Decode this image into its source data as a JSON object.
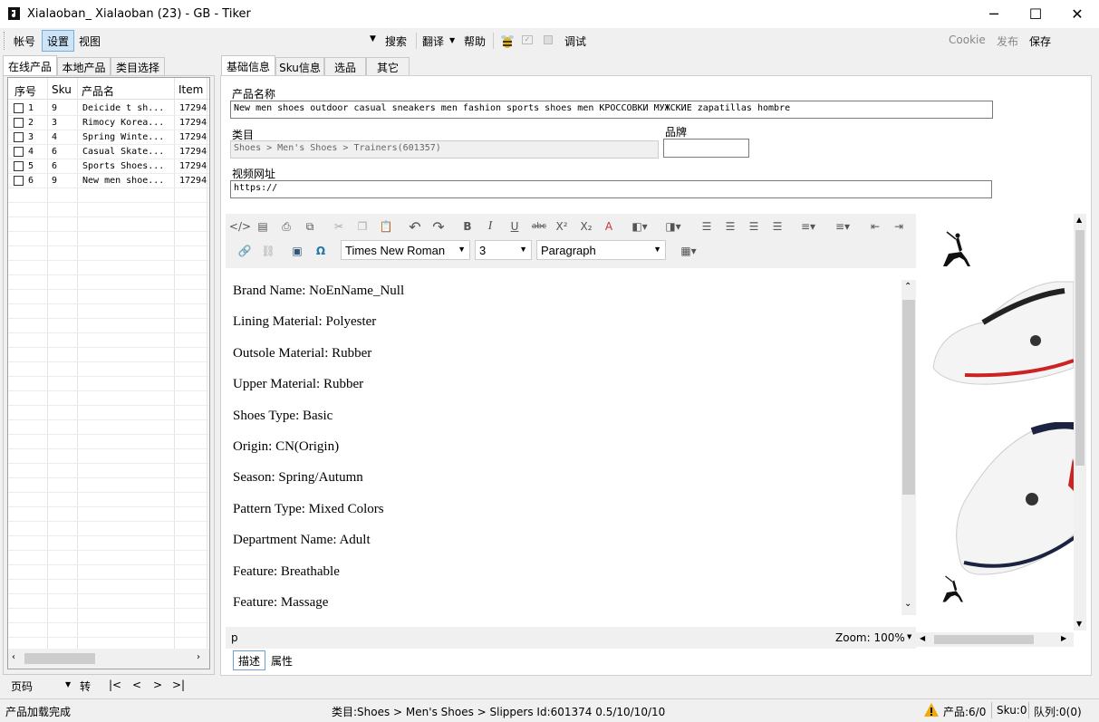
{
  "window": {
    "title": "Xialaoban_ Xialaoban (23) - GB - Tiker",
    "min": "─",
    "max": "☐",
    "close": "✕"
  },
  "menu": {
    "account": "帐号",
    "settings": "设置",
    "view": "视图",
    "search": "搜索",
    "translate": "翻译",
    "help": "帮助",
    "debug": "调试",
    "cookie": "Cookie",
    "publish": "发布",
    "save": "保存"
  },
  "left_tabs": [
    "在线产品",
    "本地产品",
    "类目选择"
  ],
  "table": {
    "headers": [
      "序号",
      "Sku",
      "产品名",
      "Item"
    ],
    "rows": [
      {
        "no": "1",
        "sku": "9",
        "name": "Deicide t sh...",
        "item": "17294"
      },
      {
        "no": "2",
        "sku": "3",
        "name": "Rimocy Korea...",
        "item": "17294"
      },
      {
        "no": "3",
        "sku": "4",
        "name": "Spring Winte...",
        "item": "17294"
      },
      {
        "no": "4",
        "sku": "6",
        "name": "Casual Skate...",
        "item": "17294"
      },
      {
        "no": "5",
        "sku": "6",
        "name": "Sports Shoes...",
        "item": "17294"
      },
      {
        "no": "6",
        "sku": "9",
        "name": "New men shoe...",
        "item": "17294"
      }
    ]
  },
  "pager": {
    "label": "页码",
    "go": "转",
    "first": "|<",
    "prev": "<",
    "next": ">",
    "last": ">|"
  },
  "form_tabs": [
    "基础信息",
    "Sku信息",
    "选品",
    "其它"
  ],
  "form": {
    "product_name_label": "产品名称",
    "product_name": "New men shoes outdoor casual sneakers men fashion sports shoes men КРОССОВКИ МУЖСКИЕ zapatillas hombre",
    "category_label": "类目",
    "category": "Shoes > Men's Shoes >  Trainers(601357)",
    "brand_label": "品牌",
    "brand": "",
    "video_label": "视频网址",
    "video": "https://"
  },
  "editor": {
    "font": "Times New Roman",
    "size": "3",
    "block": "Paragraph",
    "paragraphs": [
      "Brand Name: NoEnName_Null",
      "Lining Material: Polyester",
      "Outsole Material: Rubber",
      "Upper Material: Rubber",
      "Shoes Type: Basic",
      "Origin: CN(Origin)",
      "Season: Spring/Autumn",
      "Pattern Type: Mixed Colors",
      "Department Name: Adult",
      "Feature: Breathable",
      "Feature: Massage"
    ],
    "path": "p",
    "zoom": "Zoom: 100%"
  },
  "bottom_tabs": [
    "描述",
    "属性"
  ],
  "status": {
    "left": "产品加载完成",
    "middle": "类目:Shoes > Men's Shoes  > Slippers  Id:601374  0.5/10/10/10",
    "products": "产品:6/0",
    "sku": "Sku:0",
    "queue": "队列:0(0)"
  }
}
